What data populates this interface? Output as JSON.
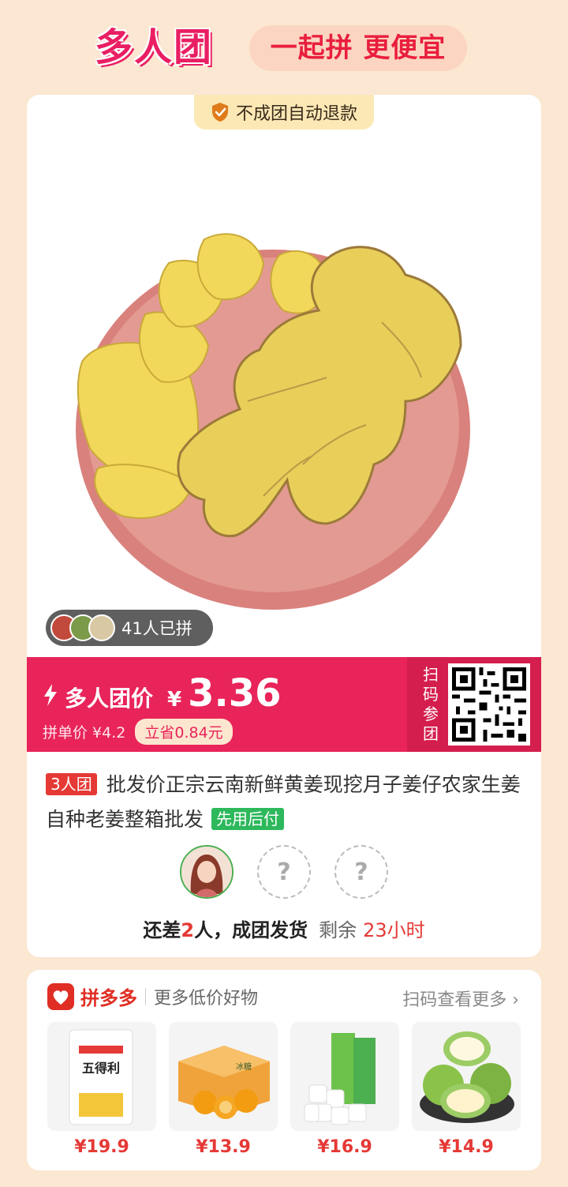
{
  "header": {
    "logo_text": "多人团",
    "slogan": "一起拼 更便宜"
  },
  "product": {
    "refund_tag": "不成团自动退款",
    "joined_count": "41人已拼",
    "price_label": "多人团价",
    "currency": "¥",
    "price": "3.36",
    "single_price": "拼单价 ¥4.2",
    "save": "立省0.84元",
    "scan_label": "扫码参团",
    "group_tag": "3人团",
    "title": "批发价正宗云南新鲜黄姜现挖月子姜仔农家生姜自种老姜整箱批发",
    "paylater": "先用后付",
    "members": [
      {
        "type": "avatar"
      },
      {
        "type": "empty",
        "symbol": "?"
      },
      {
        "type": "empty",
        "symbol": "?"
      }
    ],
    "status_prefix": "还差",
    "status_need": "2",
    "status_suffix": "人，成团发货",
    "remaining_label": "剩余",
    "remaining_time": "23小时"
  },
  "more": {
    "brand": "拼多多",
    "label": "更多低价好物",
    "scan_more": "扫码查看更多 ›",
    "items": [
      {
        "name": "五得利面粉",
        "pack_text": "五得利",
        "price": "¥19.9"
      },
      {
        "name": "冰糖橙",
        "pack_text": "冰糖",
        "price": "¥13.9"
      },
      {
        "name": "卷纸",
        "pack_text": "",
        "price": "¥16.9"
      },
      {
        "name": "芭乐",
        "pack_text": "",
        "price": "¥14.9"
      }
    ]
  },
  "colors": {
    "brand_pink": "#e8245a",
    "accent_red": "#e53935",
    "bg": "#fbe7d2"
  }
}
